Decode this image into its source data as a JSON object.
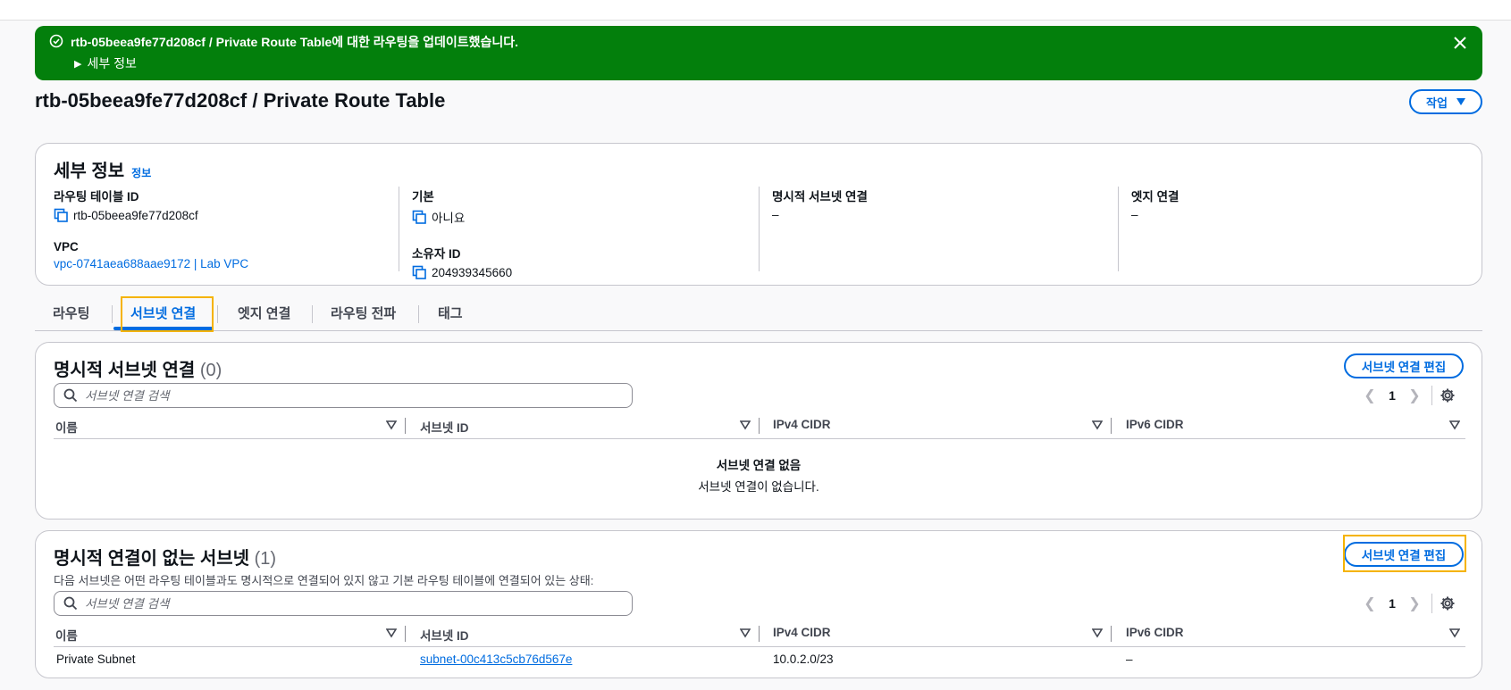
{
  "flash": {
    "message": "rtb-05beea9fe77d208cf / Private Route Table에 대한 라우팅을 업데이트했습니다.",
    "details_label": "세부 정보"
  },
  "page": {
    "title": "rtb-05beea9fe77d208cf / Private Route Table",
    "action_label": "작업"
  },
  "details": {
    "heading": "세부 정보",
    "info_link": "정보",
    "route_table_id_label": "라우팅 테이블 ID",
    "route_table_id": "rtb-05beea9fe77d208cf",
    "vpc_label": "VPC",
    "vpc_value": "vpc-0741aea688aae9172 | Lab VPC",
    "main_label": "기본",
    "main_value": "아니요",
    "owner_label": "소유자 ID",
    "owner_value": "204939345660",
    "explicit_label": "명시적 서브넷 연결",
    "explicit_value": "–",
    "edge_label": "엣지 연결",
    "edge_value": "–"
  },
  "tabs": [
    "라우팅",
    "서브넷 연결",
    "엣지 연결",
    "라우팅 전파",
    "태그"
  ],
  "explicit_section": {
    "title": "명시적 서브넷 연결",
    "count": "(0)",
    "edit_label": "서브넷 연결 편집",
    "search_placeholder": "서브넷 연결 검색",
    "page": "1",
    "columns": [
      "이름",
      "서브넷 ID",
      "IPv4 CIDR",
      "IPv6 CIDR"
    ],
    "empty_title": "서브넷 연결 없음",
    "empty_desc": "서브넷 연결이 없습니다."
  },
  "implicit_section": {
    "title": "명시적 연결이 없는 서브넷",
    "count": "(1)",
    "description": "다음 서브넷은 어떤 라우팅 테이블과도 명시적으로 연결되어 있지 않고 기본 라우팅 테이블에 연결되어 있는 상태:",
    "edit_label": "서브넷 연결 편집",
    "search_placeholder": "서브넷 연결 검색",
    "page": "1",
    "columns": [
      "이름",
      "서브넷 ID",
      "IPv4 CIDR",
      "IPv6 CIDR"
    ],
    "rows": [
      {
        "name": "Private Subnet",
        "subnet_id": "subnet-00c413c5cb76d567e",
        "ipv4": "10.0.2.0/23",
        "ipv6": "–"
      }
    ]
  },
  "colors": {
    "success": "#037f0c",
    "accent": "#006ce0",
    "highlight": "#f5b300"
  }
}
